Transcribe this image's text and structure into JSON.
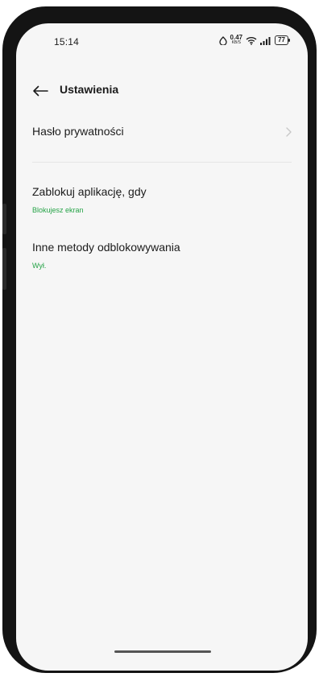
{
  "status_bar": {
    "time": "15:14",
    "net_speed_value": "0.47",
    "net_speed_unit": "KB/S",
    "battery": "77",
    "icons": [
      "alarm-icon",
      "wifi-icon",
      "signal-icon",
      "battery-icon"
    ]
  },
  "header": {
    "back_icon": "arrow-left-icon",
    "title": "Ustawienia"
  },
  "items": [
    {
      "title": "Hasło prywatności",
      "subtitle": "",
      "chevron": true
    },
    {
      "title": "Zablokuj aplikację, gdy",
      "subtitle": "Blokujesz ekran"
    },
    {
      "title": "Inne metody odblokowywania",
      "subtitle": "Wył."
    }
  ],
  "colors": {
    "background": "#f6f6f6",
    "accent_green": "#25a347",
    "text_primary": "#1b1b1b",
    "frame": "#141414"
  }
}
